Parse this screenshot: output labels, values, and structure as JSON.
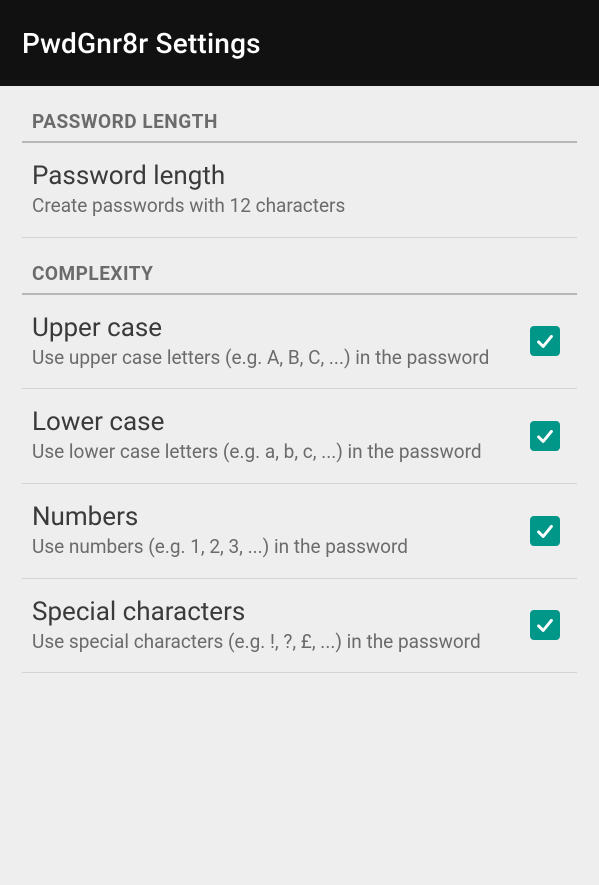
{
  "header": {
    "title": "PwdGnr8r Settings"
  },
  "sections": {
    "password_length": {
      "header": "PASSWORD LENGTH",
      "item": {
        "title": "Password length",
        "summary": "Create passwords with 12 characters"
      }
    },
    "complexity": {
      "header": "COMPLEXITY",
      "items": [
        {
          "title": "Upper case",
          "summary": "Use upper case letters (e.g. A, B, C, ...) in the password",
          "checked": true
        },
        {
          "title": "Lower case",
          "summary": "Use lower case letters (e.g. a, b, c, ...) in the password",
          "checked": true
        },
        {
          "title": "Numbers",
          "summary": "Use numbers (e.g. 1, 2, 3, ...) in the password",
          "checked": true
        },
        {
          "title": "Special characters",
          "summary": "Use special characters (e.g. !, ?, £, ...) in the password",
          "checked": true
        }
      ]
    }
  }
}
